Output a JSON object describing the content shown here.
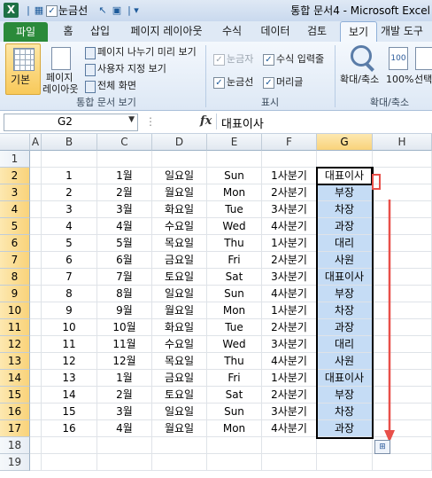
{
  "titlebar": {
    "app_icon": "excel-logo",
    "app_letter": "X",
    "quick_access_label": "눈금선",
    "title": "통합 문서4  -  Microsoft Excel"
  },
  "tabs": [
    "파일",
    "홈",
    "삽입",
    "페이지 레이아웃",
    "수식",
    "데이터",
    "검토",
    "보기",
    "개발 도구"
  ],
  "ribbon": {
    "normal_label": "기본",
    "page_layout_label_1": "페이지",
    "page_layout_label_2": "레이아웃",
    "page_break_label": "페이지 나누기 미리 보기",
    "custom_view_label": "사용자 지정 보기",
    "full_screen_label": "전체 화면",
    "group_workbook_views": "통합 문서 보기",
    "ruler_label": "눈금자",
    "formula_bar_label": "수식 입력줄",
    "gridlines_label": "눈금선",
    "headings_label": "머리글",
    "group_show": "표시",
    "zoom_label": "확대/축소",
    "zoom_100_label": "100%",
    "zoom_selection_label": "선택",
    "group_zoom": "확대/축소"
  },
  "formula_bar": {
    "name_box": "G2",
    "fx": "fx",
    "value": "대표이사"
  },
  "grid": {
    "columns": [
      "A",
      "B",
      "C",
      "D",
      "E",
      "F",
      "G",
      "H"
    ],
    "rows": [
      "1",
      "2",
      "3",
      "4",
      "5",
      "6",
      "7",
      "8",
      "9",
      "10",
      "11",
      "12",
      "13",
      "14",
      "15",
      "16",
      "17",
      "18",
      "19"
    ],
    "data": [
      [
        "1",
        "1월",
        "일요일",
        "Sun",
        "1사분기",
        "대표이사"
      ],
      [
        "2",
        "2월",
        "월요일",
        "Mon",
        "2사분기",
        "부장"
      ],
      [
        "3",
        "3월",
        "화요일",
        "Tue",
        "3사분기",
        "차장"
      ],
      [
        "4",
        "4월",
        "수요일",
        "Wed",
        "4사분기",
        "과장"
      ],
      [
        "5",
        "5월",
        "목요일",
        "Thu",
        "1사분기",
        "대리"
      ],
      [
        "6",
        "6월",
        "금요일",
        "Fri",
        "2사분기",
        "사원"
      ],
      [
        "7",
        "7월",
        "토요일",
        "Sat",
        "3사분기",
        "대표이사"
      ],
      [
        "8",
        "8월",
        "일요일",
        "Sun",
        "4사분기",
        "부장"
      ],
      [
        "9",
        "9월",
        "월요일",
        "Mon",
        "1사분기",
        "차장"
      ],
      [
        "10",
        "10월",
        "화요일",
        "Tue",
        "2사분기",
        "과장"
      ],
      [
        "11",
        "11월",
        "수요일",
        "Wed",
        "3사분기",
        "대리"
      ],
      [
        "12",
        "12월",
        "목요일",
        "Thu",
        "4사분기",
        "사원"
      ],
      [
        "13",
        "1월",
        "금요일",
        "Fri",
        "1사분기",
        "대표이사"
      ],
      [
        "14",
        "2월",
        "토요일",
        "Sat",
        "2사분기",
        "부장"
      ],
      [
        "15",
        "3월",
        "일요일",
        "Sun",
        "3사분기",
        "차장"
      ],
      [
        "16",
        "4월",
        "월요일",
        "Mon",
        "4사분기",
        "과장"
      ]
    ]
  },
  "colors": {
    "selection_fill": "#c5dcf5",
    "drag_arrow": "#e8504a",
    "file_tab": "#2a8a3a"
  }
}
